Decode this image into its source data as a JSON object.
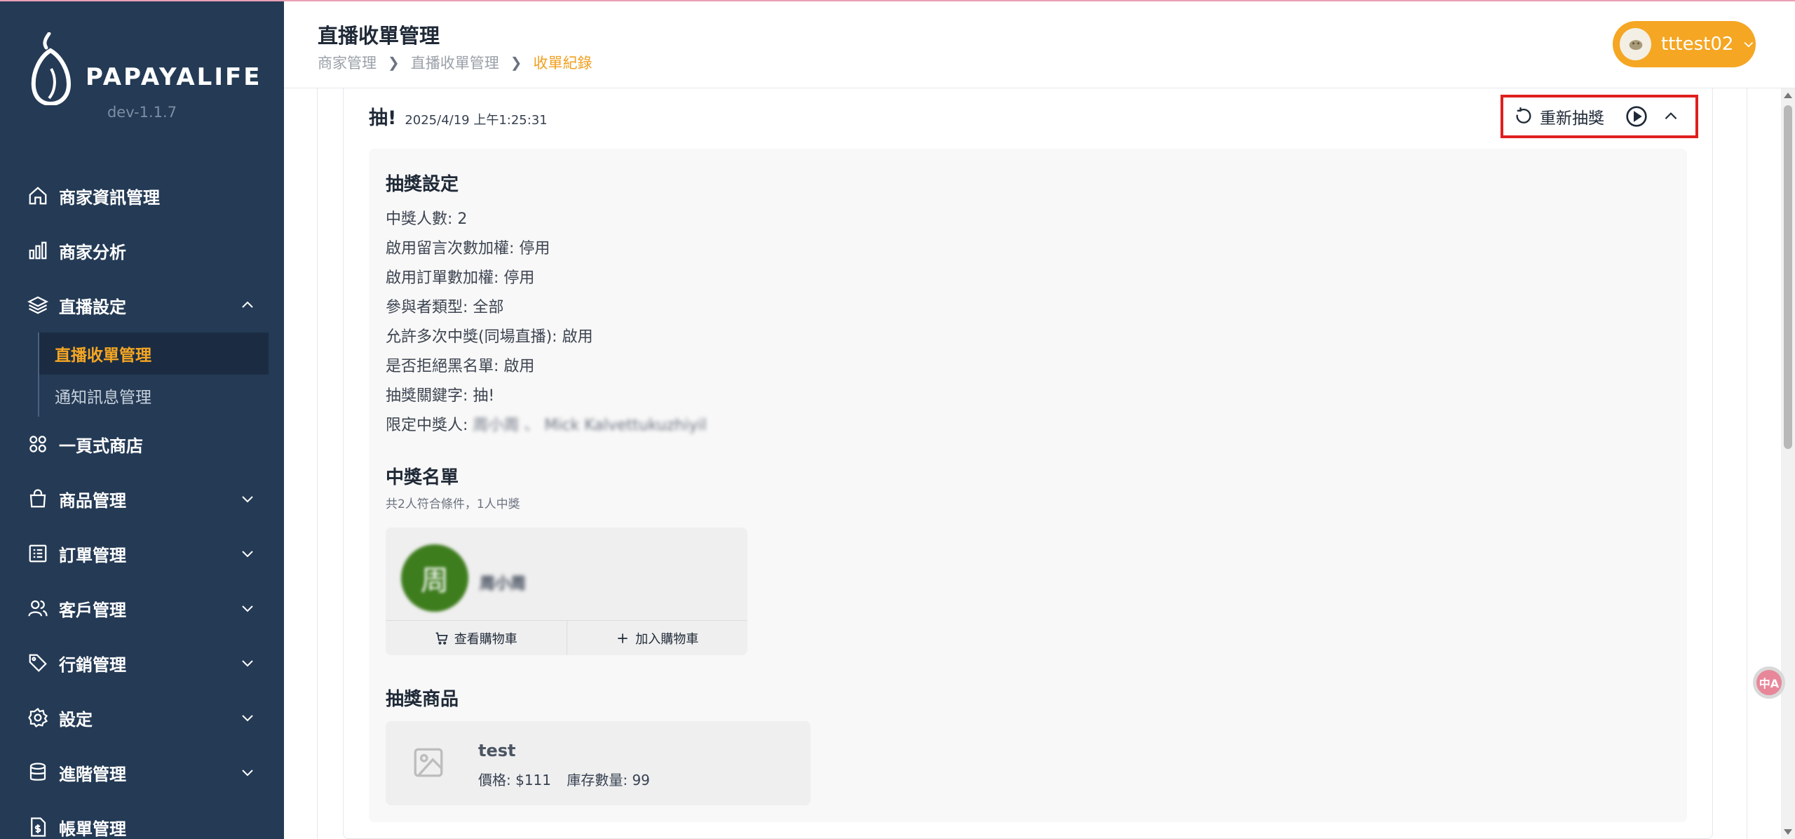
{
  "brand": {
    "name": "PAPAYALIFE",
    "version": "dev-1.1.7"
  },
  "sidebar": {
    "items": [
      {
        "label": "商家資訊管理",
        "icon": "home-icon"
      },
      {
        "label": "商家分析",
        "icon": "bar-chart-icon"
      },
      {
        "label": "直播設定",
        "icon": "layers-icon",
        "expanded": true,
        "children": [
          {
            "label": "直播收單管理",
            "active": true
          },
          {
            "label": "通知訊息管理"
          }
        ]
      },
      {
        "label": "一頁式商店",
        "icon": "grid-icon"
      },
      {
        "label": "商品管理",
        "icon": "shopping-bag-icon"
      },
      {
        "label": "訂單管理",
        "icon": "list-icon"
      },
      {
        "label": "客戶管理",
        "icon": "users-icon"
      },
      {
        "label": "行銷管理",
        "icon": "tag-icon"
      },
      {
        "label": "設定",
        "icon": "gear-icon"
      },
      {
        "label": "進階管理",
        "icon": "database-icon"
      },
      {
        "label": "帳單管理",
        "icon": "dollar-file-icon"
      }
    ]
  },
  "header": {
    "title": "直播收單管理",
    "breadcrumb": [
      "商家管理",
      "直播收單管理",
      "收單紀錄"
    ],
    "user": "tttest02"
  },
  "draw": {
    "keyword": "抽!",
    "timestamp": "2025/4/19 上午1:25:31",
    "redraw_label": "重新抽獎",
    "settings_title": "抽獎設定",
    "settings": [
      "中獎人數: 2",
      "啟用留言次數加權: 停用",
      "啟用訂單數加權: 停用",
      "參與者類型: 全部",
      "允許多次中獎(同場直播): 啟用",
      "是否拒絕黑名單: 啟用",
      "抽獎關鍵字: 抽!"
    ],
    "restricted_label": "限定中獎人:",
    "restricted_value": "周小周 、 Mick Kalvettukuzhiyil",
    "winners_title": "中獎名單",
    "winners_summary": "共2人符合條件，1人中獎",
    "winner": {
      "avatar_char": "周",
      "name": "周小周"
    },
    "view_cart": "查看購物車",
    "add_cart": "加入購物車",
    "prizes_title": "抽獎商品",
    "product": {
      "name": "test",
      "price": "價格: $111",
      "stock": "庫存數量: 99"
    }
  },
  "translate_badge": "中A",
  "colors": {
    "sidebar": "#243a55",
    "accent": "#f5a623",
    "highlight_box": "#e01f1f",
    "winner_avatar": "#3e7d1e"
  }
}
